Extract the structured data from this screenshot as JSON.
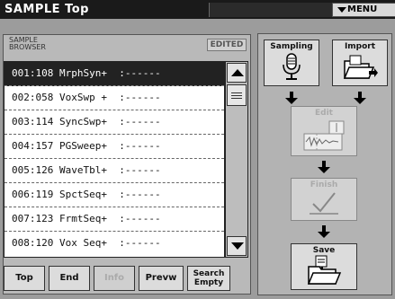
{
  "header": {
    "title": "SAMPLE Top",
    "menu_label": "MENU"
  },
  "browser": {
    "label_line1": "SAMPLE",
    "label_line2": "BROWSER",
    "edited_badge": "EDITED",
    "rows": [
      {
        "text": "001:108 MrphSyn+  :------",
        "selected": true
      },
      {
        "text": "002:058 VoxSwp +  :------",
        "selected": false
      },
      {
        "text": "003:114 SyncSwp+  :------",
        "selected": false
      },
      {
        "text": "004:157 PGSweep+  :------",
        "selected": false
      },
      {
        "text": "005:126 WaveTbl+  :------",
        "selected": false
      },
      {
        "text": "006:119 SpctSeq+  :------",
        "selected": false
      },
      {
        "text": "007:123 FrmtSeq+  :------",
        "selected": false
      },
      {
        "text": "008:120 Vox Seq+  :------",
        "selected": false
      }
    ]
  },
  "buttons": {
    "top": "Top",
    "end": "End",
    "info": "Info",
    "preview": "Prevw",
    "search_line1": "Search",
    "search_line2": "Empty"
  },
  "workflow": {
    "sampling": "Sampling",
    "import": "Import",
    "edit": "Edit",
    "finish": "Finish",
    "save": "Save"
  },
  "icons": [
    "menu-triangle-icon",
    "scroll-up-icon",
    "scroll-down-icon",
    "microphone-icon",
    "folder-import-icon",
    "waveform-edit-icon",
    "checkmark-icon",
    "folder-save-icon",
    "down-arrow-icon"
  ]
}
